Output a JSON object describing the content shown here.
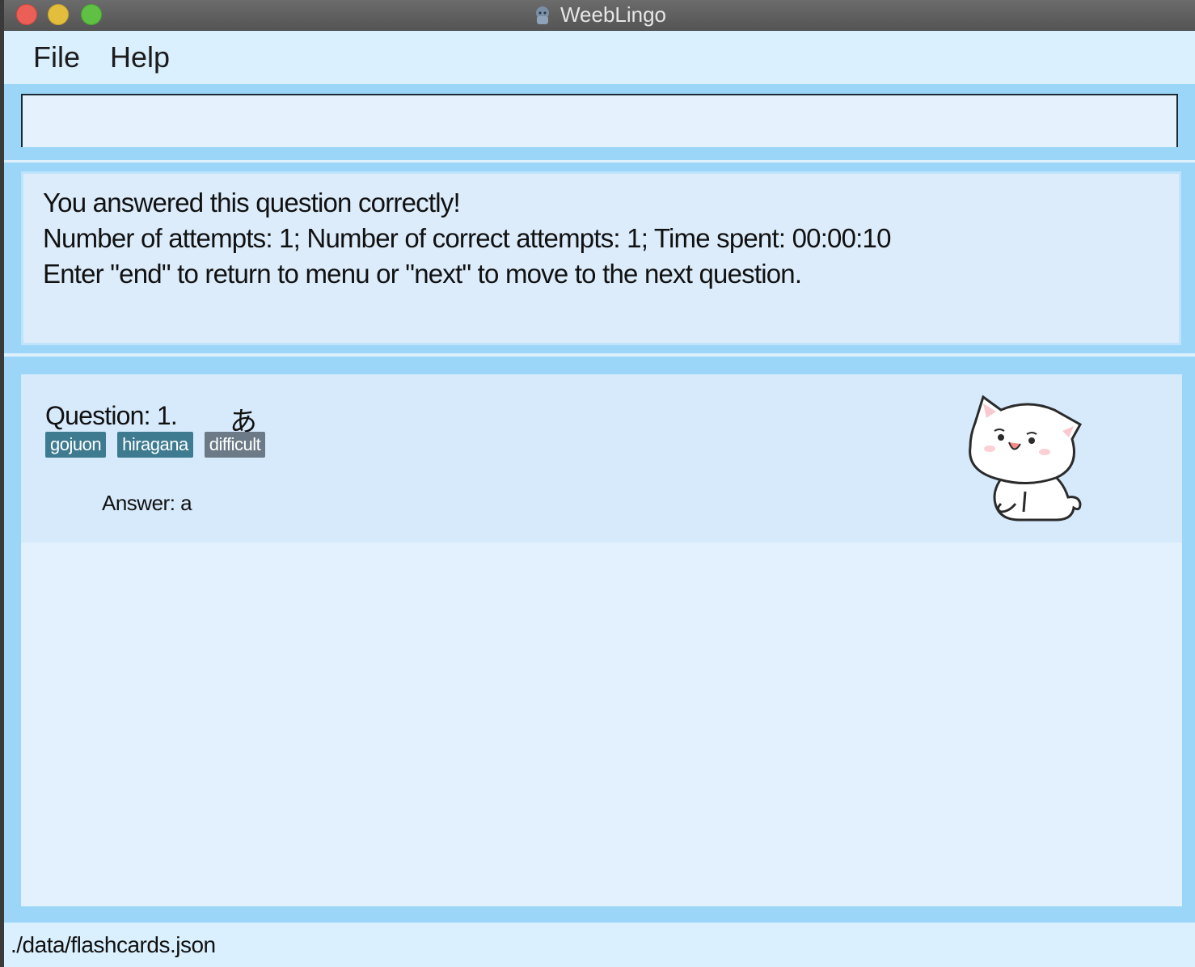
{
  "window": {
    "title": "WeebLingo"
  },
  "menu": {
    "file": "File",
    "help": "Help"
  },
  "command_box": {
    "value": "",
    "placeholder": ""
  },
  "result": {
    "line1": "You answered this question correctly!",
    "line2": "Number of attempts: 1; Number of correct attempts: 1; Time spent: 00:00:10",
    "line3": "Enter \"end\" to return to menu or \"next\" to move to the next question."
  },
  "card": {
    "question_label": "Question: 1.",
    "question_kana": "あ",
    "tags": [
      {
        "label": "gojuon",
        "color": "#3e7b91"
      },
      {
        "label": "hiragana",
        "color": "#3e7b91"
      },
      {
        "label": "difficult",
        "color": "#6b7a86"
      }
    ],
    "answer": "Answer: a"
  },
  "status_bar": {
    "path": "./data/flashcards.json"
  },
  "colors": {
    "window_bg": "#dff0fd",
    "accent_band": "#9bd6f8",
    "card_bg": "#d7eafc",
    "list_bg": "#e2f1fd"
  }
}
